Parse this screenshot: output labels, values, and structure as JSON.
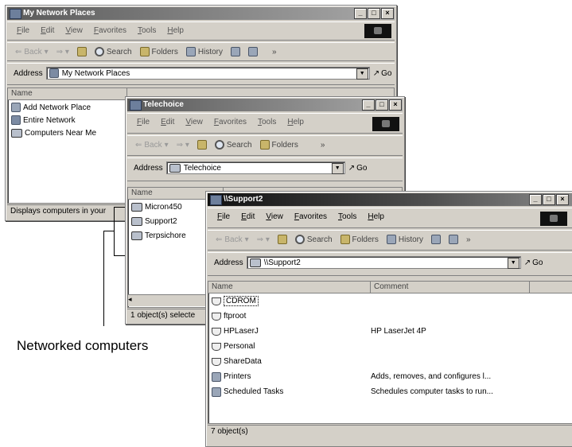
{
  "win1": {
    "title": "My Network Places",
    "menu": [
      "File",
      "Edit",
      "View",
      "Favorites",
      "Tools",
      "Help"
    ],
    "toolbar": {
      "back": "Back",
      "search": "Search",
      "folders": "Folders",
      "history": "History"
    },
    "address_label": "Address",
    "address_value": "My Network Places",
    "go": "Go",
    "col_name": "Name",
    "items": [
      "Add Network Place",
      "Entire Network",
      "Computers Near Me"
    ],
    "status": "Displays computers in your"
  },
  "win2": {
    "title": "Telechoice",
    "menu": [
      "File",
      "Edit",
      "View",
      "Favorites",
      "Tools",
      "Help"
    ],
    "toolbar": {
      "back": "Back",
      "search": "Search",
      "folders": "Folders"
    },
    "address_label": "Address",
    "address_value": "Telechoice",
    "go": "Go",
    "col_name": "Name",
    "items": [
      "Micron450",
      "Support2",
      "Terpsichore"
    ],
    "status": "1 object(s) selecte"
  },
  "win3": {
    "title": "\\\\Support2",
    "menu": [
      "File",
      "Edit",
      "View",
      "Favorites",
      "Tools",
      "Help"
    ],
    "toolbar": {
      "back": "Back",
      "search": "Search",
      "folders": "Folders",
      "history": "History"
    },
    "address_label": "Address",
    "address_value": "\\\\Support2",
    "go": "Go",
    "col_name": "Name",
    "col_comment": "Comment",
    "rows": [
      {
        "name": "CDROM",
        "comment": ""
      },
      {
        "name": "ftproot",
        "comment": ""
      },
      {
        "name": "HPLaserJ",
        "comment": "HP LaserJet 4P"
      },
      {
        "name": "Personal",
        "comment": ""
      },
      {
        "name": "ShareData",
        "comment": ""
      },
      {
        "name": "Printers",
        "comment": "Adds, removes, and configures l..."
      },
      {
        "name": "Scheduled Tasks",
        "comment": "Schedules computer tasks to run..."
      }
    ],
    "status": "7 object(s)"
  },
  "callout": "Networked computers"
}
